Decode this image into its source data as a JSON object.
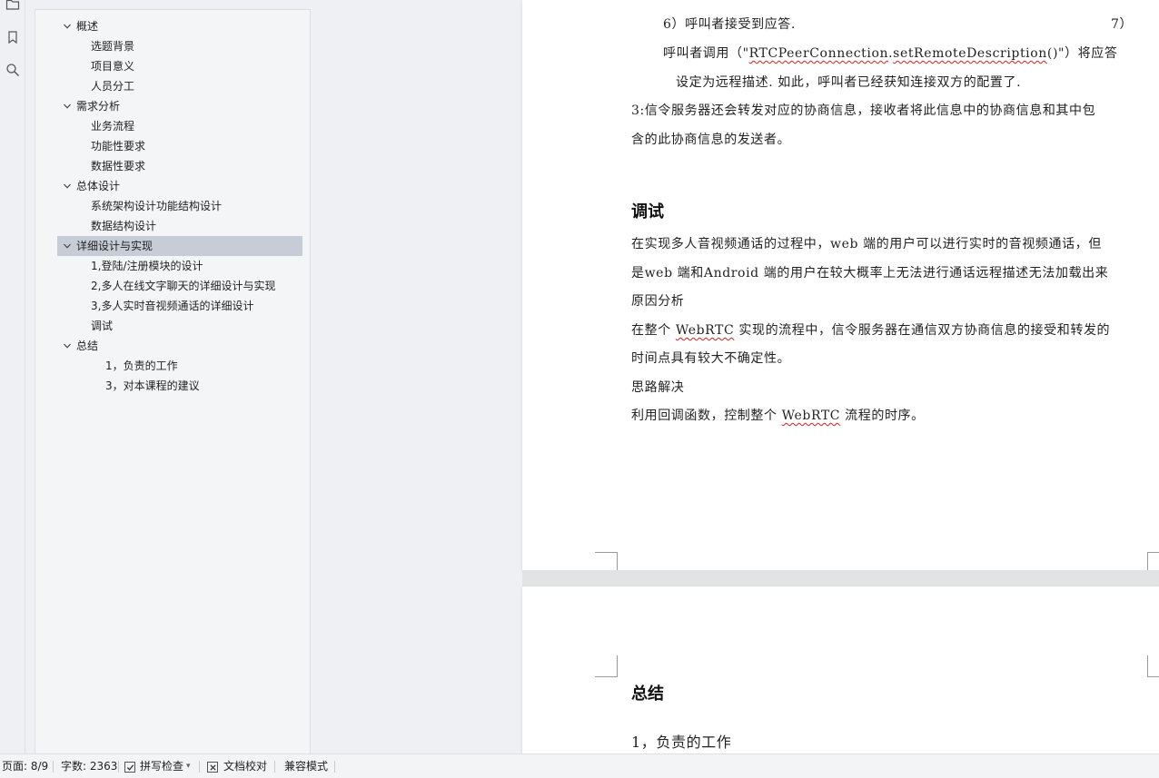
{
  "toc": {
    "items": [
      {
        "label": "概述",
        "expanded": true
      },
      {
        "label": "选题背景"
      },
      {
        "label": "项目意义"
      },
      {
        "label": "人员分工"
      },
      {
        "label": "需求分析",
        "expanded": true
      },
      {
        "label": "业务流程"
      },
      {
        "label": "功能性要求"
      },
      {
        "label": "数据性要求"
      },
      {
        "label": "总体设计",
        "expanded": true
      },
      {
        "label": "系统架构设计功能结构设计"
      },
      {
        "label": "数据结构设计"
      },
      {
        "label": "详细设计与实现",
        "expanded": true,
        "selected": true
      },
      {
        "label": "1,登陆/注册模块的设计"
      },
      {
        "label": "2,多人在线文字聊天的详细设计与实现"
      },
      {
        "label": "3,多人实时音视频通话的详细设计"
      },
      {
        "label": "调试"
      },
      {
        "label": "总结",
        "expanded": true
      },
      {
        "label": "1，负责的工作"
      },
      {
        "label": "3，对本课程的建议"
      }
    ]
  },
  "doc": {
    "page1": {
      "step6": "6）呼叫者接受到应答.",
      "step7": "7）",
      "p_callee_a": "呼叫者调用（\"",
      "p_callee_code1": "RTCPeerConnection",
      "p_callee_dot": ".",
      "p_callee_code2": "setRemoteDescription",
      "p_callee_b": "()\"）将应答",
      "p_callee_line2": "设定为远程描述. 如此，呼叫者已经获知连接双方的配置了.",
      "p3_line1": "3:信令服务器还会转发对应的协商信息，接收者将此信息中的协商信息和其中包",
      "p3_line2": "含的此协商信息的发送者。",
      "heading_debug": "调试",
      "dbg1": "在实现多人音视频通话的过程中，web 端的用户可以进行实时的音视频通话，但",
      "dbg2": "是web 端和Android 端的用户在较大概率上无法进行通话远程描述无法加载出来",
      "dbg3": "原因分析",
      "dbg4_a": "在整个 ",
      "dbg4_code": "WebRTC",
      "dbg4_b": " 实现的流程中，信令服务器在通信双方协商信息的接受和转发的",
      "dbg5": "时间点具有较大不确定性。",
      "dbg6": "思路解决",
      "dbg7_a": "利用回调函数，控制整个 ",
      "dbg7_code": "WebRTC",
      "dbg7_b": " 流程的时序。"
    },
    "page2": {
      "heading_summary": "总结",
      "line1": "1，负责的工作"
    }
  },
  "status": {
    "page": "页面: 8/9",
    "words": "字数: 2363",
    "spellcheck": "拼写检查",
    "proofread": "文档校对",
    "compat": "兼容模式"
  },
  "colors": {
    "selected_bg": "#c7cdd6",
    "squiggle": "#d02020"
  }
}
